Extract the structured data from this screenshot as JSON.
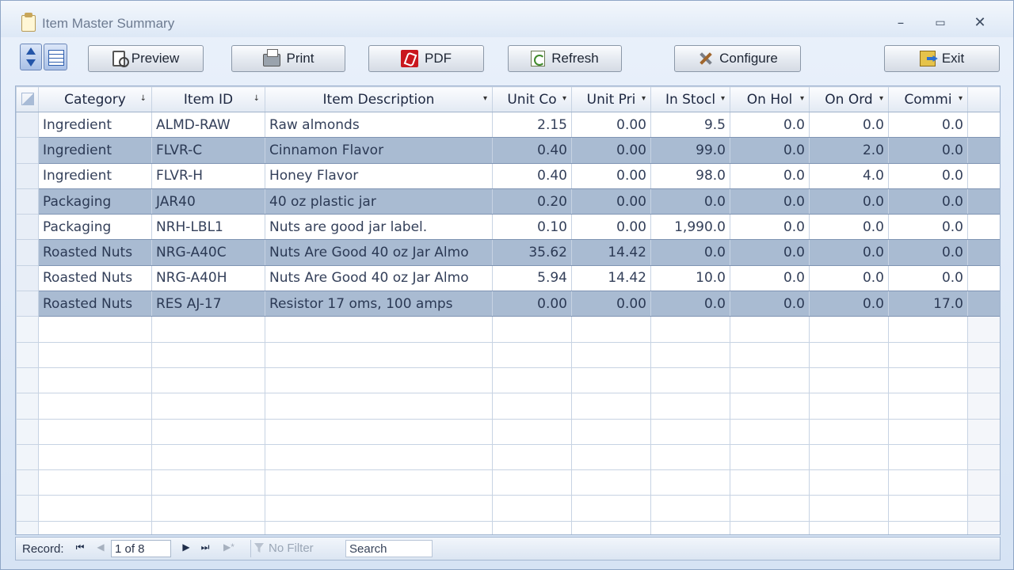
{
  "window": {
    "title": "Item Master Summary",
    "controls": {
      "minimize": "–",
      "maximize": "▭",
      "close": "✕"
    }
  },
  "toolbar": {
    "preview": "Preview",
    "print": "Print",
    "pdf": "PDF",
    "refresh": "Refresh",
    "configure": "Configure",
    "exit": "Exit"
  },
  "grid": {
    "columns": [
      "Category",
      "Item ID",
      "Item Description",
      "Unit Co",
      "Unit Pri",
      "In Stocl",
      "On Hol",
      "On Ord",
      "Commi"
    ],
    "sort_arrows": [
      "↓",
      "↓",
      "▾",
      "▾",
      "▾",
      "▾",
      "▾",
      "▾",
      "▾"
    ],
    "rows": [
      [
        "Ingredient",
        "ALMD-RAW",
        "Raw almonds",
        "2.15",
        "0.00",
        "9.5",
        "0.0",
        "0.0",
        "0.0"
      ],
      [
        "Ingredient",
        "FLVR-C",
        "Cinnamon Flavor",
        "0.40",
        "0.00",
        "99.0",
        "0.0",
        "2.0",
        "0.0"
      ],
      [
        "Ingredient",
        "FLVR-H",
        "Honey Flavor",
        "0.40",
        "0.00",
        "98.0",
        "0.0",
        "4.0",
        "0.0"
      ],
      [
        "Packaging",
        "JAR40",
        "40 oz plastic jar",
        "0.20",
        "0.00",
        "0.0",
        "0.0",
        "0.0",
        "0.0"
      ],
      [
        "Packaging",
        "NRH-LBL1",
        "Nuts are good jar label.",
        "0.10",
        "0.00",
        "1,990.0",
        "0.0",
        "0.0",
        "0.0"
      ],
      [
        "Roasted Nuts",
        "NRG-A40C",
        "Nuts Are Good 40 oz Jar Almo",
        "35.62",
        "14.42",
        "0.0",
        "0.0",
        "0.0",
        "0.0"
      ],
      [
        "Roasted Nuts",
        "NRG-A40H",
        "Nuts Are Good 40 oz Jar Almo",
        "5.94",
        "14.42",
        "10.0",
        "0.0",
        "0.0",
        "0.0"
      ],
      [
        "Roasted Nuts",
        "RES AJ-17",
        "Resistor 17 oms, 100 amps",
        "0.00",
        "0.00",
        "0.0",
        "0.0",
        "0.0",
        "17.0"
      ]
    ]
  },
  "statusbar": {
    "record_label": "Record:",
    "first": "⏮",
    "prev": "◀",
    "next": "▶",
    "last": "⏭",
    "new": "▶*",
    "record_position": "1 of 8",
    "filter_label": "No Filter",
    "search_placeholder": "Search"
  }
}
